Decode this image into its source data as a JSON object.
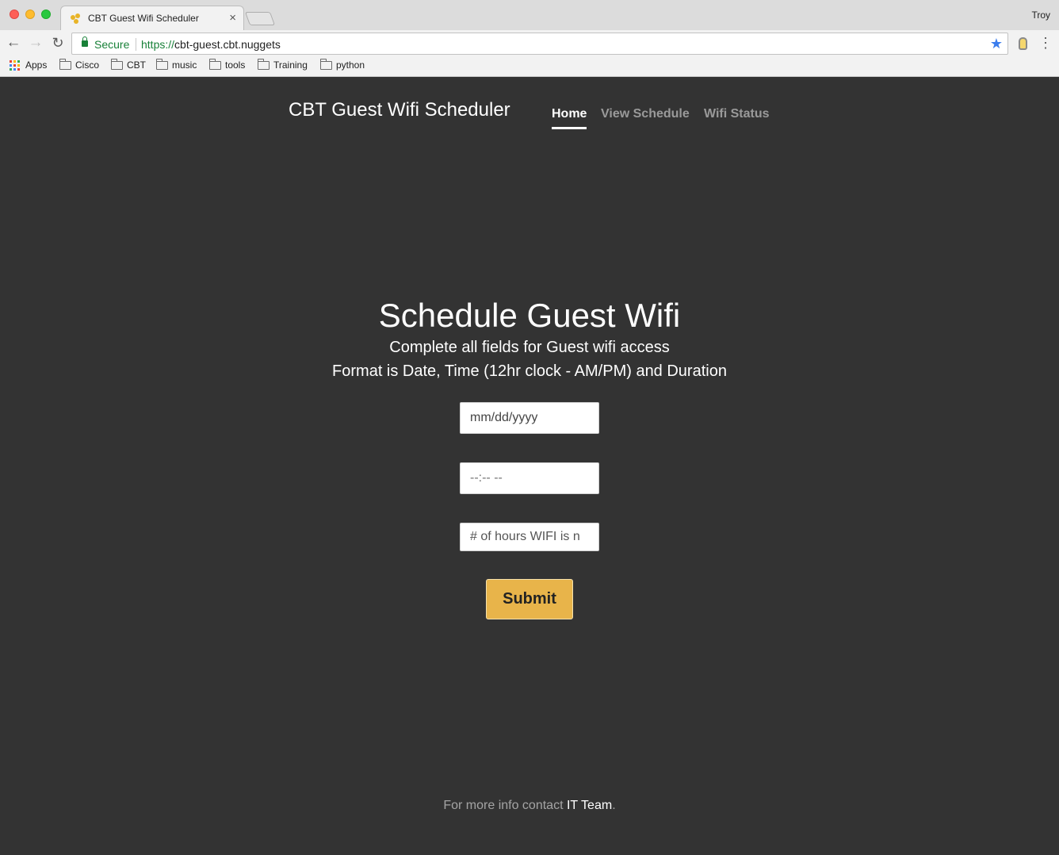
{
  "browser": {
    "tab_title": "CBT Guest Wifi Scheduler",
    "tab_close": "×",
    "profile_name": "Troy",
    "secure_label": "Secure",
    "url_scheme": "https://",
    "url_host": "cbt-guest.cbt.nuggets",
    "back_glyph": "←",
    "forward_glyph": "→",
    "reload_glyph": "↻",
    "star_glyph": "★",
    "menu_glyph": "⋮",
    "bookmarks": [
      {
        "label": "Apps",
        "icon": "apps-grid-icon"
      },
      {
        "label": "Cisco",
        "icon": "folder-icon"
      },
      {
        "label": "CBT",
        "icon": "folder-icon"
      },
      {
        "label": "music",
        "icon": "folder-icon"
      },
      {
        "label": "tools",
        "icon": "folder-icon"
      },
      {
        "label": "Training",
        "icon": "folder-icon"
      },
      {
        "label": "python",
        "icon": "folder-icon"
      }
    ]
  },
  "site": {
    "brand": "CBT Guest Wifi Scheduler",
    "nav": [
      {
        "label": "Home",
        "active": true
      },
      {
        "label": "View Schedule",
        "active": false
      },
      {
        "label": "Wifi Status",
        "active": false
      }
    ]
  },
  "main": {
    "heading": "Schedule Guest Wifi",
    "lead_line1": "Complete all fields for Guest wifi access",
    "lead_line2": "Format is Date, Time (12hr clock - AM/PM) and Duration",
    "date_field": "mm/dd/yyyy",
    "time_field": "--:-- --",
    "hours_placeholder": "# of hours WIFI is n",
    "submit_label": "Submit"
  },
  "footer": {
    "prefix": "For more info contact ",
    "contact": "IT Team",
    "suffix": "."
  },
  "colors": {
    "page_background": "#333333",
    "submit_button": "#e8b44a",
    "secure_green": "#188038"
  }
}
